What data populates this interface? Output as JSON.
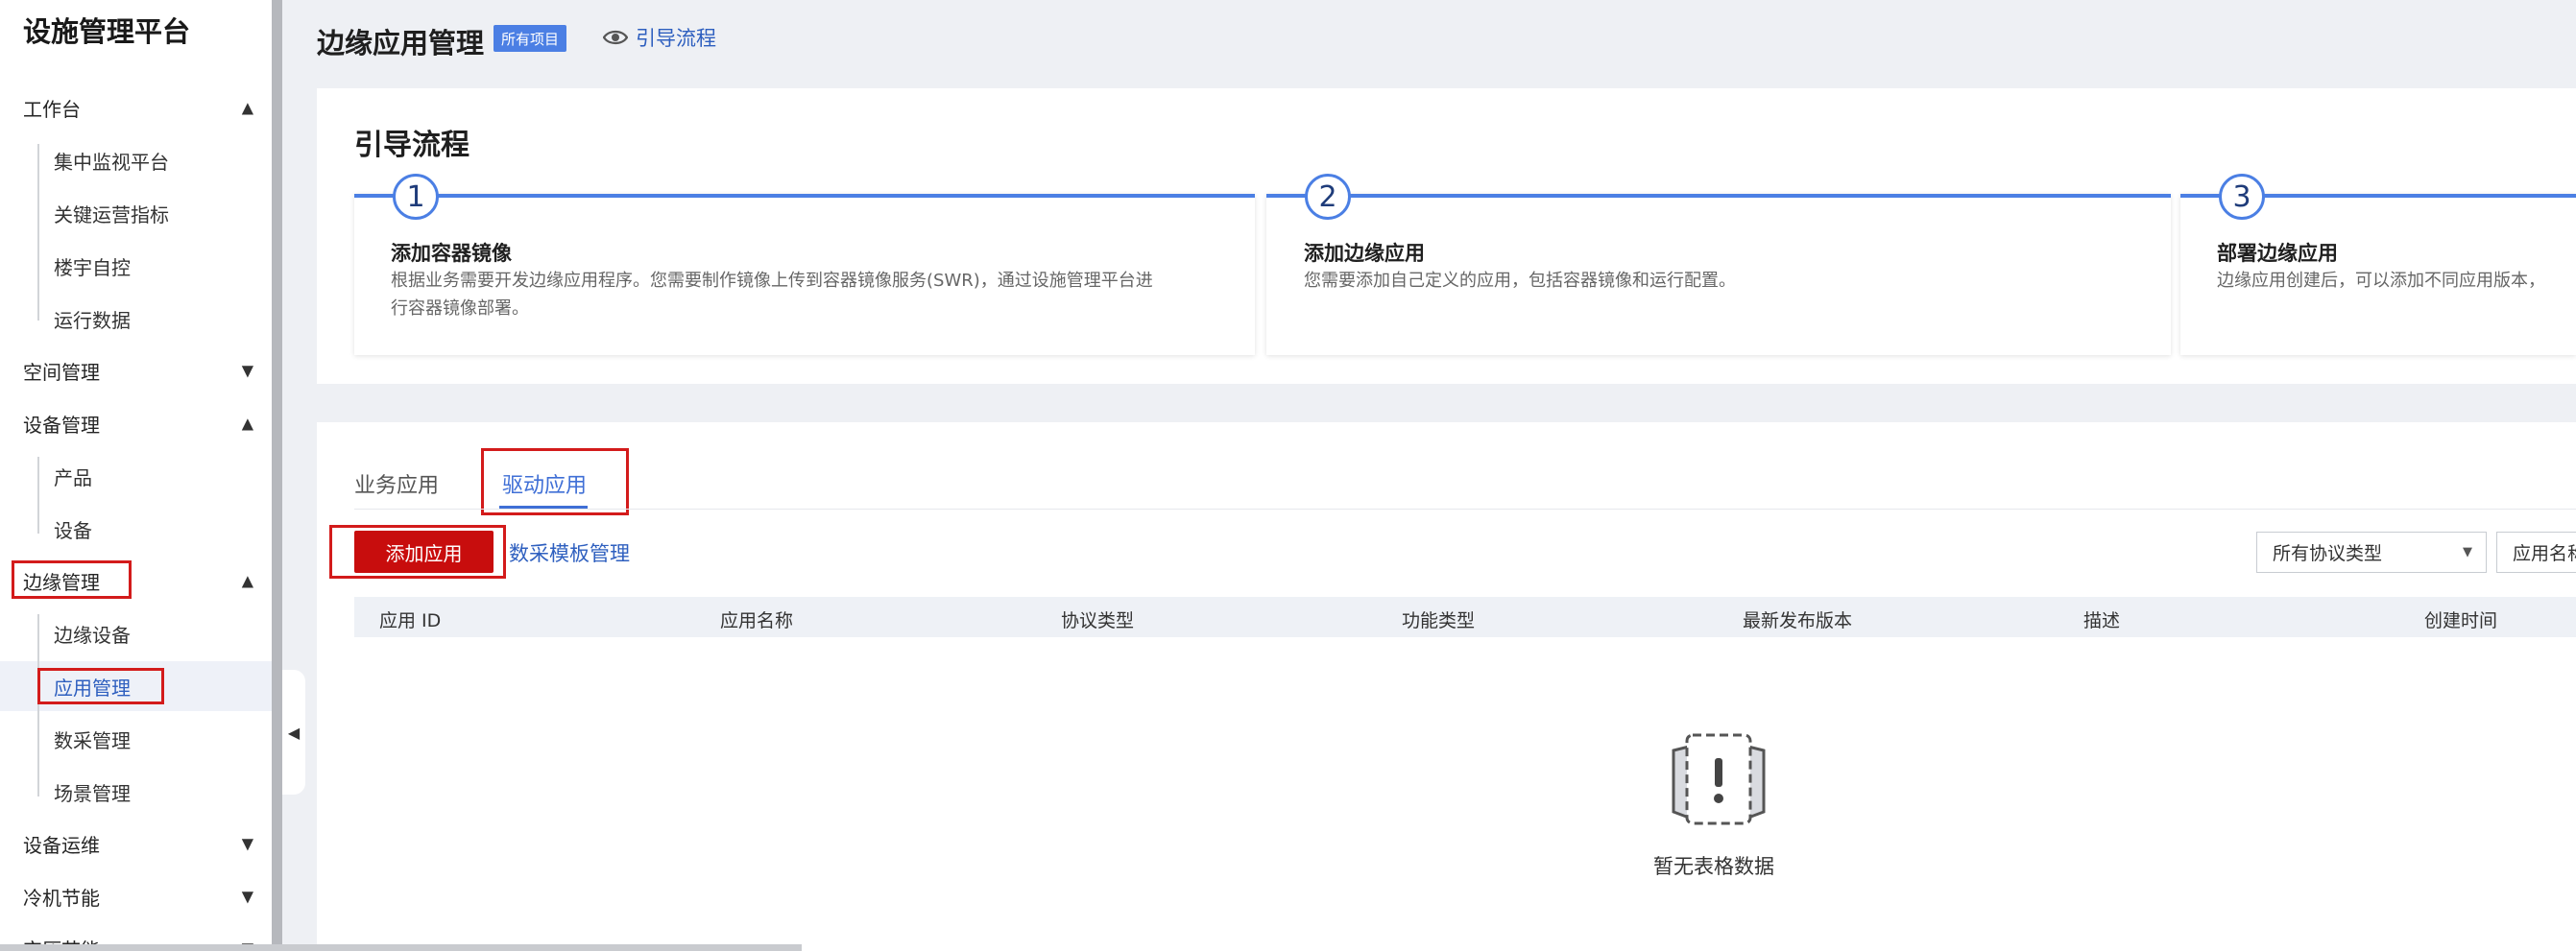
{
  "sidebar": {
    "brand": "设施管理平台",
    "groups": [
      {
        "label": "工作台",
        "arrow": "▲",
        "subitems": [
          "集中监视平台",
          "关键运营指标",
          "楼宇自控",
          "运行数据"
        ]
      },
      {
        "label": "空间管理",
        "arrow": "▼"
      },
      {
        "label": "设备管理",
        "arrow": "▲",
        "subitems": [
          "产品",
          "设备"
        ]
      },
      {
        "label": "边缘管理",
        "arrow": "▲",
        "subitems": [
          "边缘设备",
          "应用管理",
          "数采管理",
          "场景管理"
        ]
      },
      {
        "label": "设备运维",
        "arrow": "▼"
      },
      {
        "label": "冷机节能",
        "arrow": "▼"
      },
      {
        "label": "空压节能",
        "arrow": "▼"
      }
    ]
  },
  "header": {
    "title": "边缘应用管理",
    "badge": "所有项目",
    "guide_link": "引导流程"
  },
  "guide": {
    "title": "引导流程",
    "steps": [
      {
        "num": "1",
        "title": "添加容器镜像",
        "desc_line1": "根据业务需要开发边缘应用程序。您需要制作镜像上传到容器镜像服务(SWR)，通过设施管理平台进",
        "desc_line2": "行容器镜像部署。"
      },
      {
        "num": "2",
        "title": "添加边缘应用",
        "desc_line1": "您需要添加自己定义的应用，包括容器镜像和运行配置。",
        "desc_line2": ""
      },
      {
        "num": "3",
        "title": "部署边缘应用",
        "desc_line1": "边缘应用创建后，可以添加不同应用版本，",
        "desc_line2": ""
      }
    ]
  },
  "tabs": [
    "业务应用",
    "驱动应用"
  ],
  "toolbar": {
    "add_button": "添加应用",
    "template_link": "数采模板管理",
    "protocol_select": "所有协议类型",
    "search_placeholder": "应用名称"
  },
  "table": {
    "columns": [
      "应用 ID",
      "应用名称",
      "协议类型",
      "功能类型",
      "最新发布版本",
      "描述",
      "创建时间"
    ],
    "empty_text": "暂无表格数据"
  },
  "colors": {
    "accent": "#4b7fe4",
    "primary_red": "#c80d0d",
    "highlight_box": "#d31b1b"
  }
}
